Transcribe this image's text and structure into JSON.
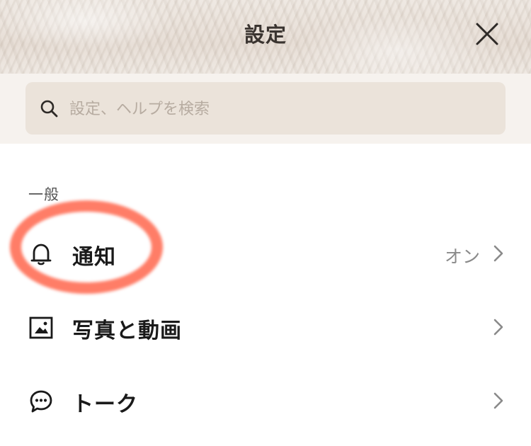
{
  "header": {
    "title": "設定",
    "close_icon": "close-icon"
  },
  "search": {
    "placeholder": "設定、ヘルプを検索",
    "value": "",
    "icon": "search-icon"
  },
  "sections": [
    {
      "label": "一般",
      "items": [
        {
          "label": "通知",
          "value": "オン",
          "icon": "bell-icon"
        },
        {
          "label": "写真と動画",
          "value": "",
          "icon": "photo-icon"
        },
        {
          "label": "トーク",
          "value": "",
          "icon": "chat-bubble-icon"
        }
      ]
    }
  ],
  "highlight": {
    "target": "通知",
    "color": "#ff6046"
  },
  "colors": {
    "header_bg": "#ebe3da",
    "search_band_bg": "#f6f2ee",
    "search_box_bg": "#ebe3da"
  }
}
